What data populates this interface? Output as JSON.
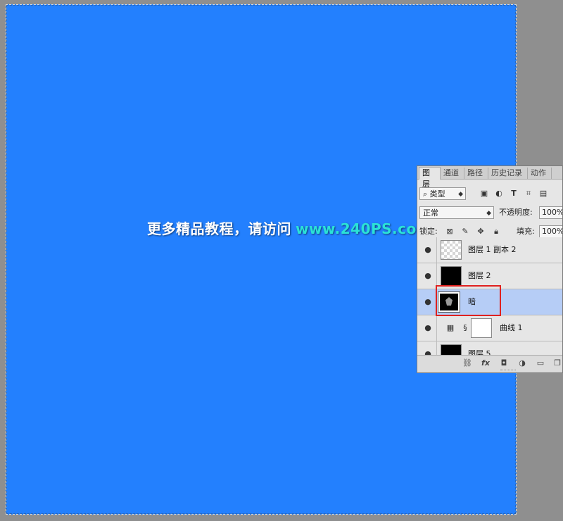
{
  "watermark": {
    "chinese": "更多精品教程，请访问",
    "url": "www.240PS.com"
  },
  "panel": {
    "tabs": [
      "图层",
      "通道",
      "路径",
      "历史记录",
      "动作"
    ],
    "active_tab": "图层",
    "filter_kind": "类型",
    "blend_mode": "正常",
    "opacity_label": "不透明度:",
    "opacity_value": "100%",
    "lock_label": "锁定:",
    "fill_label": "填充:",
    "fill_value": "100%",
    "layers": [
      {
        "name": "图层 1 副本 2",
        "thumb": "transparent",
        "selected": false
      },
      {
        "name": "图层 2",
        "thumb": "black",
        "selected": false
      },
      {
        "name": "暗",
        "thumb": "black-shape",
        "selected": true
      },
      {
        "name": "曲线 1",
        "thumb": "adjustment-mask",
        "selected": false
      },
      {
        "name": "图层 5",
        "thumb": "black-shape",
        "selected": false
      }
    ]
  },
  "colors": {
    "canvas": "#2380fe",
    "highlight_box": "#e0211f",
    "selected_layer": "#b6cdf6",
    "url_text": "#2be2d6"
  }
}
